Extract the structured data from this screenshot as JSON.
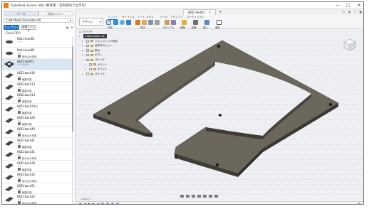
{
  "window": {
    "title": "Autodesk Fusion 360 (教育用 - 営利目的では不可)",
    "minimize": "—",
    "maximize": "□",
    "close": "✕"
  },
  "left_panel": {
    "tabs": [
      "データ",
      "共有メンバー"
    ],
    "project": "Craft Mode Simulator.lc0",
    "upload_label": "アップロード",
    "new_folder_label": "新規フォルダ",
    "breadcrumb": "Dual CIPO",
    "files": [
      {
        "name": "Bolt.Head01",
        "version": "V1",
        "status": ""
      },
      {
        "name": "Bolt.Head02",
        "version": "V1",
        "status": "読み込み専用"
      },
      {
        "name": "HDD.feet01",
        "version": "V2  18:29",
        "status": "",
        "selected": true
      },
      {
        "name": "HDD.back10",
        "version": "V1",
        "status": "編集可能"
      },
      {
        "name": "HDD.back13",
        "version": "V1",
        "status": "編集可能"
      },
      {
        "name": "HDD.back14",
        "version": "V1",
        "status": "編集可能"
      },
      {
        "name": "HDD.back20.b",
        "version": "V1",
        "status": "編集可能"
      },
      {
        "name": "HDD.back20",
        "version": "V1",
        "status": "編集可能"
      },
      {
        "name": "HDD.back40",
        "version": "V1",
        "status": "読み込み専用"
      },
      {
        "name": "HDD.back41",
        "version": "V1",
        "status": "編集可能"
      },
      {
        "name": "HDD.back31",
        "version": "V1",
        "status": "読み込み専用"
      },
      {
        "name": "HDD.back30",
        "version": "V1",
        "status": "編集可能"
      },
      {
        "name": "HDD.back33",
        "version": "V1",
        "status": "読み込み専用"
      },
      {
        "name": "HDD.back21",
        "version": "V1",
        "status": "編集可能"
      },
      {
        "name": "HDD.back22",
        "version": "V1",
        "status": "読み込み専用"
      }
    ]
  },
  "document_tab": {
    "label": "HDD.feet01"
  },
  "toolbar": {
    "workspace": "デザイン",
    "ribbon_tabs": [
      "ソリッド",
      "サーフェス",
      "シート メタル",
      "ツール",
      "アセンブリ",
      "ユーティリティ"
    ],
    "groups": [
      "作成",
      "修正",
      "アセンブリ",
      "構築",
      "検査",
      "挿入",
      "選択"
    ]
  },
  "browser": {
    "header": "ブラウザ",
    "root": "HDD.feet01 v2",
    "nodes": [
      "ドキュメントの設定",
      "名前付きビュー",
      "原点",
      "ボディ",
      "スケッチ",
      "ボディ1",
      "ボディ2",
      "スケッチ"
    ]
  },
  "comments": {
    "label": "コメント"
  },
  "colors": {
    "part_top": "#6b675c",
    "part_side": "#3f3c35",
    "accent": "#1d73c8",
    "viewport_bg": "#eef0f3"
  }
}
